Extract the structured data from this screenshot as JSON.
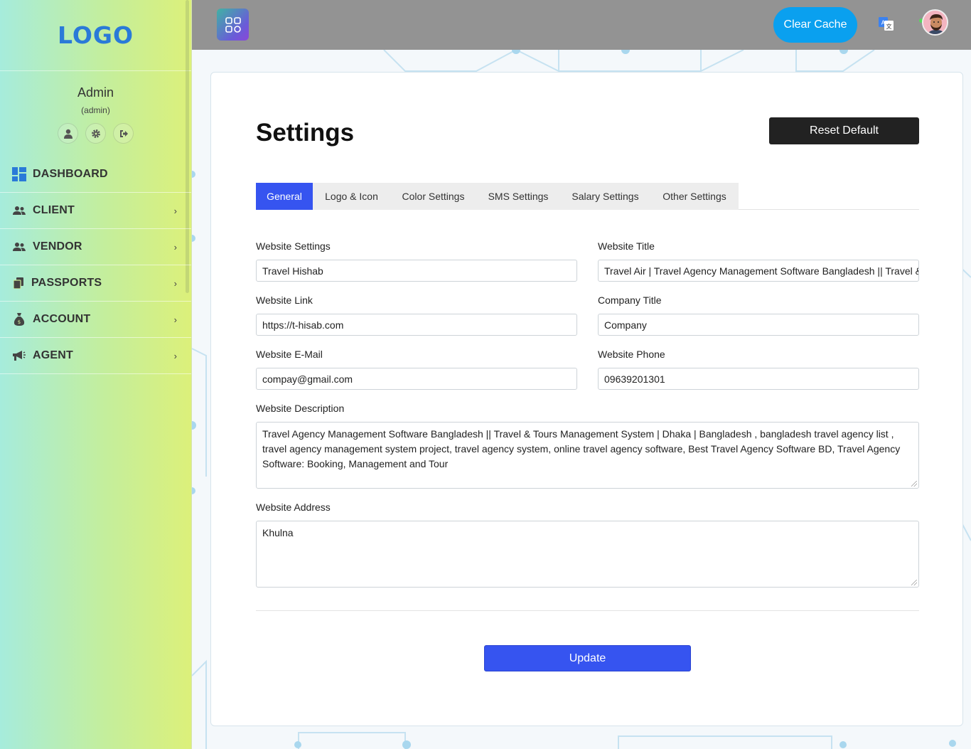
{
  "sidebar": {
    "logo": "LOGO",
    "user_name": "Admin",
    "user_role": "(admin)",
    "profile_icons": [
      "user-icon",
      "gear-icon",
      "sign-out-icon"
    ],
    "items": [
      {
        "label": "DASHBOARD",
        "icon": "dashboard-icon",
        "has_submenu": false
      },
      {
        "label": "CLIENT",
        "icon": "users-icon",
        "has_submenu": true
      },
      {
        "label": "VENDOR",
        "icon": "users-icon",
        "has_submenu": true
      },
      {
        "label": "PASSPORTS",
        "icon": "copy-icon",
        "has_submenu": true
      },
      {
        "label": "ACCOUNT",
        "icon": "money-bag-icon",
        "has_submenu": true
      },
      {
        "label": "AGENT",
        "icon": "megaphone-icon",
        "has_submenu": true
      }
    ]
  },
  "topbar": {
    "apps_icon": "grid-icon",
    "clear_cache_label": "Clear Cache",
    "translate_icon": "translate-icon",
    "avatar": "avatar"
  },
  "page": {
    "title": "Settings",
    "reset_label": "Reset Default",
    "tabs": [
      {
        "label": "General",
        "active": true
      },
      {
        "label": "Logo & Icon",
        "active": false
      },
      {
        "label": "Color Settings",
        "active": false
      },
      {
        "label": "SMS Settings",
        "active": false
      },
      {
        "label": "Salary Settings",
        "active": false
      },
      {
        "label": "Other Settings",
        "active": false
      }
    ],
    "fields": {
      "website_settings": {
        "label": "Website Settings",
        "value": "Travel Hishab"
      },
      "website_title": {
        "label": "Website Title",
        "value": "Travel Air | Travel Agency Management Software Bangladesh || Travel & Tours Management System"
      },
      "website_link": {
        "label": "Website Link",
        "value": "https://t-hisab.com"
      },
      "company_title": {
        "label": "Company Title",
        "value": "Company"
      },
      "website_email": {
        "label": "Website E-Mail",
        "value": "compay@gmail.com"
      },
      "website_phone": {
        "label": "Website Phone",
        "value": "09639201301"
      },
      "website_description": {
        "label": "Website Description",
        "value": "Travel Agency Management Software Bangladesh || Travel & Tours Management System | Dhaka | Bangladesh , bangladesh travel agency list , travel agency management system project, travel agency system, online travel agency software, Best Travel Agency Software BD, Travel Agency Software: Booking, Management and Tour"
      },
      "website_address": {
        "label": "Website Address",
        "value": "Khulna"
      }
    },
    "update_label": "Update"
  },
  "colors": {
    "accent": "#3654f0",
    "clear_cache": "#0aa0ef",
    "logo": "#2a7ad8",
    "dark_button": "#222222"
  }
}
